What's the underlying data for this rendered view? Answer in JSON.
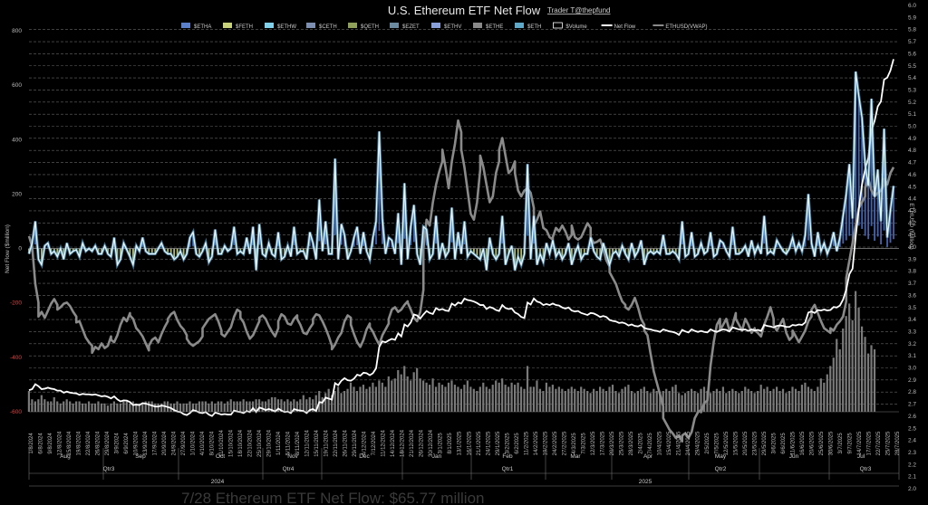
{
  "chart_data": {
    "type": "line",
    "title": "U.S. Ethereum ETF Net Flow",
    "credit": "Trader T@thepfund",
    "ylabel": "Net Flow ($million)",
    "y2label": "ETHUSD (Million)",
    "ylim": [
      -600,
      800
    ],
    "y2lim": [
      2.0,
      6.0
    ],
    "left_ticks": [
      "800",
      "600",
      "400",
      "200",
      "0",
      "-200",
      "-400",
      "-600"
    ],
    "right_ticks": [
      "6.0",
      "5.9",
      "5.8",
      "5.7",
      "5.6",
      "5.5",
      "5.4",
      "5.3",
      "5.2",
      "5.1",
      "5.0",
      "4.9",
      "4.8",
      "4.7",
      "4.6",
      "4.5",
      "4.4",
      "4.3",
      "4.2",
      "4.1",
      "4.0",
      "3.9",
      "3.8",
      "3.7",
      "3.6",
      "3.5",
      "3.4",
      "3.3",
      "3.2",
      "3.1",
      "3.0",
      "2.9",
      "2.8",
      "2.7",
      "2.6",
      "2.5",
      "2.4",
      "2.3",
      "2.2",
      "2.1",
      "2.0"
    ],
    "legend": [
      "$ETHA",
      "$FETH",
      "$ETHW",
      "$CETH",
      "$QETH",
      "$EZET",
      "$ETHV",
      "$ETHE",
      "$ETH",
      "$Volume",
      "Net Flow",
      "ETHUSD(VWAP)"
    ],
    "legend_colors": [
      "#5b7fc8",
      "#c8d27a",
      "#7fd0e8",
      "#7d8fb0",
      "#8fa05a",
      "#6c8aa0",
      "#8aa0d8",
      "#8a8a8a",
      "#5fa8c8",
      "#ffffff",
      "#ffffff",
      "#8a8a8a"
    ],
    "x_dates": [
      "1/8/2024",
      "6/8/2024",
      "9/8/2024",
      "12/8/2024",
      "15/8/2024",
      "19/8/2024",
      "22/8/2024",
      "26/8/2024",
      "29/8/2024",
      "3/9/2024",
      "6/9/2024",
      "10/9/2024",
      "13/9/2024",
      "17/9/2024",
      "20/9/2024",
      "24/9/2024",
      "27/9/2024",
      "1/10/2024",
      "4/10/2024",
      "8/10/2024",
      "11/10/2024",
      "15/10/2024",
      "18/10/2024",
      "22/10/2024",
      "25/10/2024",
      "29/10/2024",
      "1/11/2024",
      "5/11/2024",
      "8/11/2024",
      "12/11/2024",
      "15/11/2024",
      "19/11/2024",
      "22/11/2024",
      "26/11/2024",
      "29/11/2024",
      "4/12/2024",
      "7/12/2024",
      "11/12/2024",
      "14/12/2024",
      "18/12/2024",
      "21/12/2024",
      "26/12/2024",
      "30/12/2024",
      "3/1/2025",
      "8/1/2025",
      "13/1/2025",
      "16/1/2025",
      "21/1/2025",
      "24/1/2025",
      "29/1/2025",
      "3/2/2025",
      "6/2/2025",
      "11/2/2025",
      "14/2/2025",
      "19/2/2025",
      "24/2/2025",
      "27/2/2025",
      "4/3/2025",
      "7/3/2025",
      "12/3/2025",
      "17/3/2025",
      "20/3/2025",
      "25/3/2025",
      "28/3/2025",
      "2/4/2025",
      "7/4/2025",
      "10/4/2025",
      "15/4/2025",
      "21/4/2025",
      "24/4/2025",
      "29/4/2025",
      "2/5/2025",
      "7/5/2025",
      "12/5/2025",
      "15/5/2025",
      "20/5/2025",
      "23/5/2025",
      "29/5/2025",
      "3/6/2025",
      "6/6/2025",
      "11/6/2025",
      "16/6/2025",
      "20/6/2025",
      "25/6/2025",
      "30/6/2025",
      "3/7/2025",
      "9/7/2025",
      "14/7/2025",
      "17/7/2025",
      "22/7/2025",
      "25/7/2025",
      "28/7/2025"
    ],
    "months": [
      "Aug",
      "Sep",
      "Oct",
      "Nov",
      "Dec",
      "Jan",
      "Feb",
      "Mar",
      "Apr",
      "May",
      "Jun",
      "Jul"
    ],
    "quarters": [
      "Qtr3",
      "Qtr4",
      "Qtr1",
      "Qtr2",
      "Qtr3"
    ],
    "years": [
      "2024",
      "2025"
    ],
    "caption": "7/28 Ethereum ETF Net Flow: $65.77 million",
    "series": [
      {
        "name": "Net Flow",
        "unit": "$million",
        "values": [
          -20,
          20,
          100,
          -40,
          -60,
          10,
          20,
          -20,
          -10,
          -30,
          0,
          -40,
          20,
          -20,
          -10,
          -5,
          -30,
          20,
          -10,
          0,
          -10,
          10,
          -20,
          -20,
          10,
          -20,
          -30,
          40,
          -60,
          -40,
          20,
          -5,
          -30,
          -60,
          10,
          -10,
          40,
          -10,
          -20,
          -20,
          -20,
          0,
          20,
          -10,
          -20,
          -20,
          -40,
          -30,
          -10,
          -40,
          -20,
          40,
          60,
          -20,
          -30,
          -10,
          20,
          -50,
          -30,
          70,
          -20,
          -20,
          10,
          -10,
          0,
          80,
          -20,
          -10,
          -20,
          40,
          -20,
          80,
          -80,
          90,
          -20,
          -30,
          20,
          -20,
          -30,
          60,
          -40,
          -30,
          10,
          -30,
          80,
          -20,
          -10,
          -10,
          -40,
          60,
          20,
          -40,
          180,
          -10,
          100,
          -20,
          -20,
          330,
          -40,
          90,
          50,
          -40,
          -10,
          40,
          80,
          -20,
          60,
          -10,
          -40,
          40,
          100,
          430,
          110,
          -20,
          40,
          30,
          -20,
          130,
          -60,
          240,
          -40,
          80,
          160,
          -20,
          -60,
          80,
          70,
          -40,
          -20,
          120,
          -40,
          20,
          -30,
          -10,
          150,
          -40,
          60,
          -20,
          100,
          -30,
          -10,
          -20,
          -30,
          -40,
          0,
          -80,
          40,
          -20,
          -40,
          -20,
          120,
          -60,
          -20,
          10,
          -80,
          -30,
          -60,
          -20,
          310,
          -40,
          120,
          -60,
          -20,
          -50,
          20,
          -20,
          30,
          -30,
          -10,
          -40,
          -20,
          20,
          -60,
          -20,
          10,
          -40,
          -20,
          -20,
          40,
          -10,
          -30,
          -40,
          20,
          -20,
          -60,
          -20,
          -10,
          -30,
          10,
          -20,
          -40,
          20,
          -30,
          -10,
          30,
          -60,
          -20,
          -10,
          -20,
          -10,
          -20,
          50,
          -20,
          -20,
          -10,
          -20,
          -40,
          100,
          -30,
          -20,
          60,
          -30,
          -20,
          20,
          -20,
          -10,
          60,
          -30,
          -20,
          30,
          20,
          -10,
          -30,
          80,
          -20,
          -20,
          -10,
          10,
          -30,
          30,
          -20,
          10,
          -20,
          120,
          -20,
          -10,
          -20,
          30,
          10,
          -10,
          -20,
          0,
          40,
          -10,
          20,
          -10,
          50,
          200,
          20,
          -30,
          60,
          -10,
          20,
          -20,
          10,
          60,
          -10,
          40,
          120,
          200,
          310,
          110,
          650,
          560,
          480,
          310,
          230,
          550,
          190,
          290,
          100,
          440,
          40,
          140,
          230
        ],
        "color": "#e6f4ff"
      },
      {
        "name": "ETHUSD(VWAP)",
        "unit": "$",
        "values": [
          3.31,
          3.22,
          2.9,
          2.74,
          2.62,
          2.66,
          2.61,
          2.67,
          2.73,
          2.77,
          2.72,
          2.68,
          2.7,
          2.73,
          2.74,
          2.71,
          2.66,
          2.62,
          2.57,
          2.58,
          2.51,
          2.44,
          2.4,
          2.37,
          2.31,
          2.36,
          2.34,
          2.39,
          2.35,
          2.37,
          2.45,
          2.42,
          2.4,
          2.46,
          2.55,
          2.61,
          2.58,
          2.65,
          2.63,
          2.6,
          2.52,
          2.49,
          2.45,
          2.39,
          2.33,
          2.37,
          2.42,
          2.44,
          2.4,
          2.47,
          2.53,
          2.58,
          2.6,
          2.64,
          2.66,
          2.59,
          2.54,
          2.51,
          2.46,
          2.43,
          2.39,
          2.37,
          2.39,
          2.41,
          2.45,
          2.52,
          2.56,
          2.6,
          2.62,
          2.64,
          2.58,
          2.5,
          2.47,
          2.45,
          2.49,
          2.53,
          2.62,
          2.68,
          2.66,
          2.61,
          2.57,
          2.49,
          2.43,
          2.46,
          2.52,
          2.58,
          2.61,
          2.63,
          2.6,
          2.54,
          2.49,
          2.45,
          2.52,
          2.58,
          2.64,
          2.62,
          2.56,
          2.55,
          2.6,
          2.63,
          2.6,
          2.55,
          2.48,
          2.47,
          2.52,
          2.56,
          2.6,
          2.64,
          2.63,
          2.58,
          2.52,
          2.45,
          2.37,
          2.34,
          2.38,
          2.44,
          2.48,
          2.58,
          2.63,
          2.61,
          2.55,
          2.47,
          2.4,
          2.36,
          2.42,
          2.51,
          2.56,
          2.53,
          2.49,
          2.43,
          2.38,
          2.46,
          2.51,
          2.56,
          2.6,
          2.68,
          2.7,
          2.66,
          2.68,
          2.72,
          2.75,
          2.74,
          2.68,
          2.61,
          2.58,
          2.66,
          2.85,
          3.2,
          3.45,
          3.4,
          3.6,
          3.75,
          3.86,
          3.95,
          4.05,
          3.9,
          3.72,
          3.95,
          4.1,
          4.3,
          4.2,
          4.05,
          3.9,
          3.7,
          3.5,
          3.45,
          3.6,
          3.88,
          4.0,
          3.9,
          3.75,
          3.6,
          3.65,
          3.85,
          3.95,
          4.05,
          4.15,
          4.0,
          3.85,
          3.88,
          3.95,
          3.85,
          3.7,
          3.65,
          3.7,
          3.72,
          3.68,
          3.55,
          3.4,
          3.45,
          3.52,
          3.38,
          3.36,
          3.3,
          3.28,
          3.3,
          3.38,
          3.35,
          3.4,
          3.35,
          3.28,
          3.32,
          3.4,
          3.3,
          3.28,
          3.3,
          3.36,
          3.42,
          3.38,
          3.3,
          3.25,
          3.26,
          3.28,
          3.2,
          3.1,
          3.05,
          3.0,
          2.95,
          2.9,
          2.82,
          2.75,
          2.72,
          2.7,
          2.68,
          2.72,
          2.78,
          2.7,
          2.6,
          2.55,
          2.5,
          2.46,
          2.3,
          2.15,
          2.05,
          1.95,
          1.85,
          1.75,
          1.7,
          1.65,
          1.62,
          1.58,
          1.6,
          1.55,
          1.6,
          1.62,
          1.58,
          1.63,
          1.75,
          1.8,
          1.82,
          1.8,
          1.88,
          1.9,
          2.2,
          2.4,
          2.55,
          2.6,
          2.5,
          2.55,
          2.6,
          2.5,
          2.55,
          2.65,
          2.6,
          2.55,
          2.5,
          2.6,
          2.55,
          2.48,
          2.52,
          2.5,
          2.48,
          2.45,
          2.55,
          2.62,
          2.7,
          2.6,
          2.55,
          2.5,
          2.55,
          2.6,
          2.48,
          2.42,
          2.45,
          2.5,
          2.45,
          2.4,
          2.45,
          2.5,
          2.58,
          2.62,
          2.68,
          2.72,
          2.65,
          2.58,
          2.52,
          2.5,
          2.48,
          2.52,
          2.5,
          2.55,
          2.58,
          2.62,
          2.75,
          2.95,
          3.1,
          3.25,
          3.4,
          3.55,
          3.6,
          3.65,
          3.72,
          3.8,
          3.7,
          3.65,
          3.68,
          3.7,
          3.75,
          3.8,
          3.75,
          3.85,
          3.9
        ]
      },
      {
        "name": "$Volume",
        "unit": "$million",
        "values_scale": "bars",
        "values": [
          0.1,
          0.06,
          0.05,
          0.06,
          0.08,
          0.06,
          0.05,
          0.05,
          0.07,
          0.05,
          0.04,
          0.05,
          0.06,
          0.05,
          0.04,
          0.05,
          0.05,
          0.04,
          0.04,
          0.05,
          0.04,
          0.04,
          0.05,
          0.04,
          0.04,
          0.03,
          0.04,
          0.05,
          0.04,
          0.04,
          0.05,
          0.05,
          0.04,
          0.05,
          0.04,
          0.04,
          0.04,
          0.05,
          0.05,
          0.05,
          0.04,
          0.04,
          0.04,
          0.05,
          0.05,
          0.04,
          0.04,
          0.05,
          0.04,
          0.04,
          0.04,
          0.05,
          0.04,
          0.04,
          0.05,
          0.05,
          0.05,
          0.04,
          0.05,
          0.04,
          0.05,
          0.05,
          0.04,
          0.05,
          0.06,
          0.05,
          0.05,
          0.05,
          0.06,
          0.05,
          0.05,
          0.05,
          0.06,
          0.06,
          0.05,
          0.05,
          0.06,
          0.07,
          0.07,
          0.06,
          0.06,
          0.05,
          0.06,
          0.05,
          0.06,
          0.05,
          0.06,
          0.08,
          0.06,
          0.07,
          0.06,
          0.08,
          0.1,
          0.07,
          0.09,
          0.11,
          0.08,
          0.1,
          0.12,
          0.09,
          0.1,
          0.11,
          0.14,
          0.12,
          0.1,
          0.12,
          0.13,
          0.11,
          0.12,
          0.14,
          0.12,
          0.15,
          0.14,
          0.12,
          0.17,
          0.15,
          0.16,
          0.2,
          0.18,
          0.22,
          0.17,
          0.15,
          0.19,
          0.21,
          0.16,
          0.15,
          0.14,
          0.13,
          0.16,
          0.12,
          0.14,
          0.13,
          0.12,
          0.14,
          0.15,
          0.13,
          0.12,
          0.11,
          0.13,
          0.15,
          0.12,
          0.11,
          0.1,
          0.12,
          0.14,
          0.12,
          0.11,
          0.13,
          0.15,
          0.14,
          0.16,
          0.13,
          0.12,
          0.14,
          0.13,
          0.14,
          0.12,
          0.11,
          0.22,
          0.12,
          0.12,
          0.15,
          0.11,
          0.1,
          0.14,
          0.12,
          0.13,
          0.11,
          0.12,
          0.11,
          0.1,
          0.11,
          0.12,
          0.11,
          0.1,
          0.12,
          0.11,
          0.1,
          0.09,
          0.11,
          0.1,
          0.12,
          0.11,
          0.1,
          0.12,
          0.13,
          0.1,
          0.09,
          0.11,
          0.12,
          0.13,
          0.1,
          0.09,
          0.1,
          0.11,
          0.12,
          0.1,
          0.09,
          0.11,
          0.1,
          0.09,
          0.1,
          0.11,
          0.1,
          0.12,
          0.13,
          0.09,
          0.08,
          0.09,
          0.1,
          0.11,
          0.1,
          0.09,
          0.11,
          0.12,
          0.1,
          0.09,
          0.1,
          0.11,
          0.1,
          0.12,
          0.09,
          0.1,
          0.11,
          0.1,
          0.09,
          0.1,
          0.12,
          0.11,
          0.1,
          0.09,
          0.1,
          0.13,
          0.11,
          0.12,
          0.1,
          0.11,
          0.12,
          0.1,
          0.11,
          0.09,
          0.1,
          0.12,
          0.11,
          0.1,
          0.13,
          0.14,
          0.12,
          0.11,
          0.1,
          0.12,
          0.16,
          0.14,
          0.18,
          0.22,
          0.26,
          0.35,
          0.3,
          0.4,
          0.46,
          0.52,
          0.44,
          0.58,
          0.5,
          0.41,
          0.36,
          0.28,
          0.32,
          0.3
        ]
      }
    ]
  }
}
